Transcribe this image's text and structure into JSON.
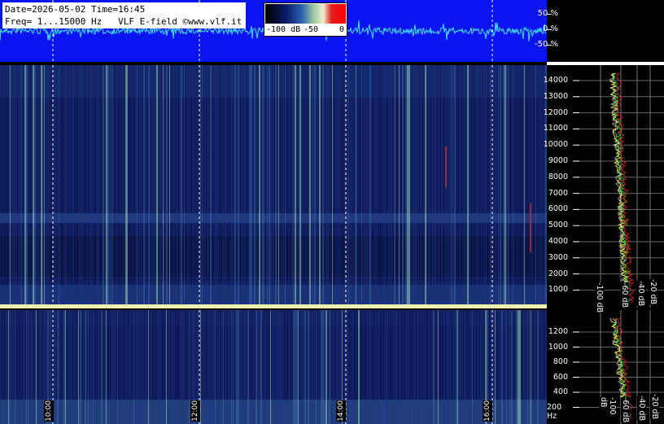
{
  "info": {
    "line1": "Date=2026-05-02 Time=16:45",
    "line2": "Freq= 1...15000 Hz   VLF E-field ©www.vlf.it"
  },
  "colorbar": {
    "labels": [
      "-100 dB",
      "-50",
      "0"
    ]
  },
  "amplitude_scale": [
    "50 %",
    "0 %",
    "-50 %"
  ],
  "time_labels": [
    "10:00",
    "12:00",
    "14:00",
    "16:00"
  ],
  "freq_top": [
    "14000",
    "13000",
    "12000",
    "11000",
    "10000",
    "9000",
    "8000",
    "7000",
    "6000",
    "5000",
    "4000",
    "3000",
    "2000",
    "1000"
  ],
  "freq_bottom": [
    "1200",
    "1000",
    "800",
    "600",
    "400",
    "200 Hz"
  ],
  "db_labels": [
    "-100 dB",
    "-60 dB",
    "-40 dB",
    "-20 dB"
  ],
  "colors": {
    "waveform_bg": "#0a14f0",
    "waveform": "#40e0ff",
    "spectrogram_bg": "#0a0f3a"
  }
}
